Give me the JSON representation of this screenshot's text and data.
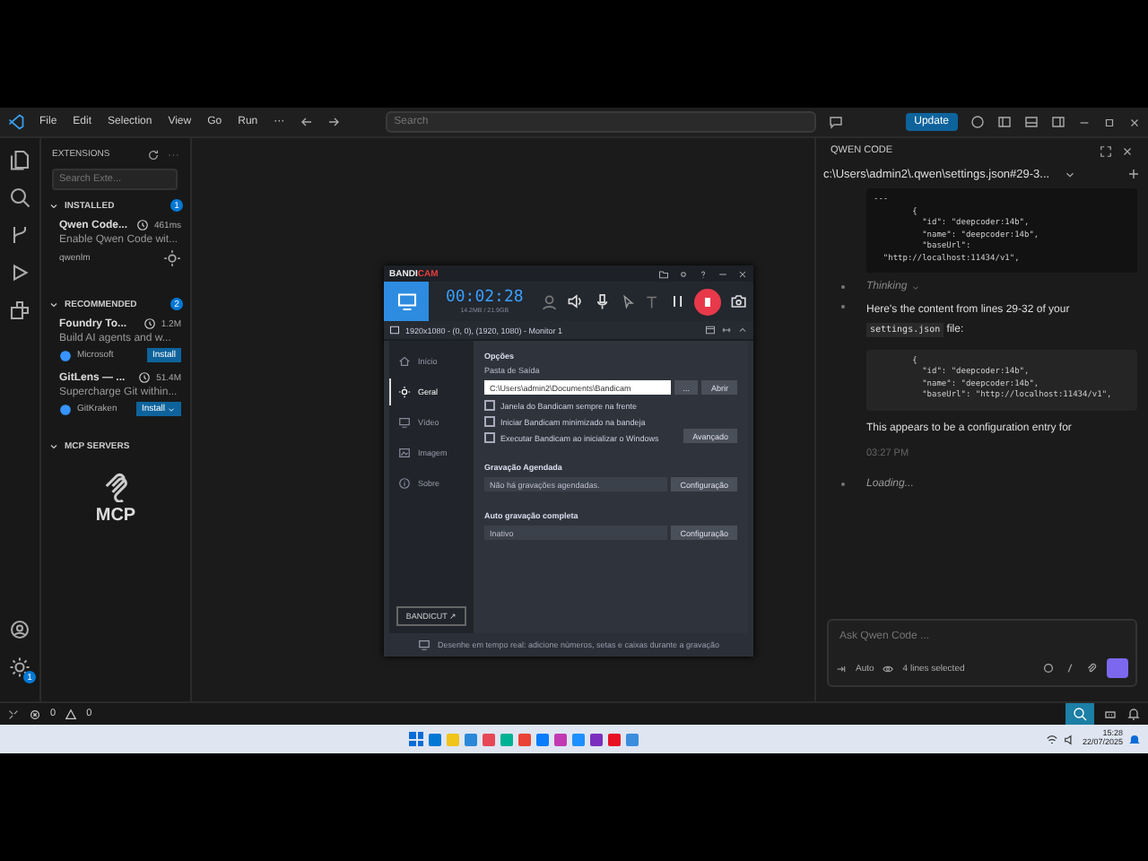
{
  "titlebar": {
    "menu": [
      "File",
      "Edit",
      "Selection",
      "View",
      "Go",
      "Run",
      "···"
    ],
    "search": {
      "placeholder": "Search"
    },
    "update": "Update"
  },
  "activity_bar": {
    "settings_badge": "1"
  },
  "sidebar": {
    "title": "EXTENSIONS",
    "search": {
      "placeholder": "Search Exte..."
    },
    "sections": [
      {
        "title": "INSTALLED",
        "count": "1",
        "expanded": true,
        "items": [
          {
            "kind": "installed",
            "name": "Qwen Code...",
            "stat": "461ms",
            "desc": "Enable Qwen Code wit...",
            "publisher": "qwenlm"
          }
        ]
      },
      {
        "title": "RECOMMENDED",
        "count": "2",
        "expanded": true,
        "items": [
          {
            "kind": "install",
            "name": "Foundry To...",
            "stat": "1.2M",
            "desc": "Build AI agents and w...",
            "publisher": "Microsoft",
            "action": "Install"
          },
          {
            "kind": "install_split",
            "name": "GitLens — ...",
            "stat": "51.4M",
            "desc": "Supercharge Git within...",
            "publisher": "GitKraken",
            "action": "Install"
          }
        ]
      },
      {
        "title": "MCP SERVERS",
        "expanded": true,
        "logo_text": "MCP"
      }
    ]
  },
  "bandicam": {
    "logo": [
      "BANDI",
      "CAM"
    ],
    "timer": "00:02:28",
    "size": "14.2MB / 21.9GB",
    "target": "1920x1080 - (0, 0), (1920, 1080) - Monitor 1",
    "nav": [
      {
        "label": "Início",
        "selected": false
      },
      {
        "label": "Geral",
        "selected": true
      },
      {
        "label": "Vídeo",
        "selected": false
      },
      {
        "label": "Imagem",
        "selected": false
      },
      {
        "label": "Sobre",
        "selected": false
      }
    ],
    "bandicut": "BANDICUT ↗",
    "options_title": "Opções",
    "folder_label": "Pasta de Saída",
    "folder_value": "C:\\Users\\admin2\\Documents\\Bandicam",
    "browse": "...",
    "open": "Abrir",
    "checkboxes": [
      {
        "label": "Janela do Bandicam sempre na frente",
        "checked": false
      },
      {
        "label": "Iniciar Bandicam minimizado na bandeja",
        "checked": false
      },
      {
        "label": "Executar Bandicam ao inicializar o Windows",
        "checked": false
      }
    ],
    "advanced": "Avançado",
    "scheduled": {
      "title": "Gravação Agendada",
      "value": "Não há gravações agendadas.",
      "button": "Configuração"
    },
    "auto": {
      "title": "Auto gravação completa",
      "value": "Inativo",
      "button": "Configuração"
    },
    "tip": "Desenhe em tempo real: adicione números, setas e caixas durante a gravação"
  },
  "qwen": {
    "title": "QWEN CODE",
    "session": "c:\\Users\\admin2\\.qwen\\settings.json#29-3...",
    "code1": [
      "---",
      "        {",
      "          \"id\": \"deepcoder:14b\",",
      "          \"name\": \"deepcoder:14b\",",
      "          \"baseUrl\":",
      "  \"http://localhost:11434/v1\","
    ],
    "thinking": "Thinking",
    "message": {
      "before": "Here's the content from lines 29-32 of your ",
      "code": "settings.json",
      "after": " file:"
    },
    "code2": [
      "        {",
      "          \"id\": \"deepcoder:14b\",",
      "          \"name\": \"deepcoder:14b\",",
      "          \"baseUrl\": \"http://localhost:11434/v1\","
    ],
    "reply": "This appears to be a configuration entry for",
    "time": "03:27 PM",
    "loading": "Loading...",
    "input": {
      "placeholder": "Ask Qwen Code ...",
      "mode": "Auto",
      "selection": "4 lines selected"
    }
  },
  "status_bar": {
    "errors": "0",
    "warnings": "0"
  },
  "taskbar": {
    "time": "15:28",
    "date": "22/07/2025"
  }
}
